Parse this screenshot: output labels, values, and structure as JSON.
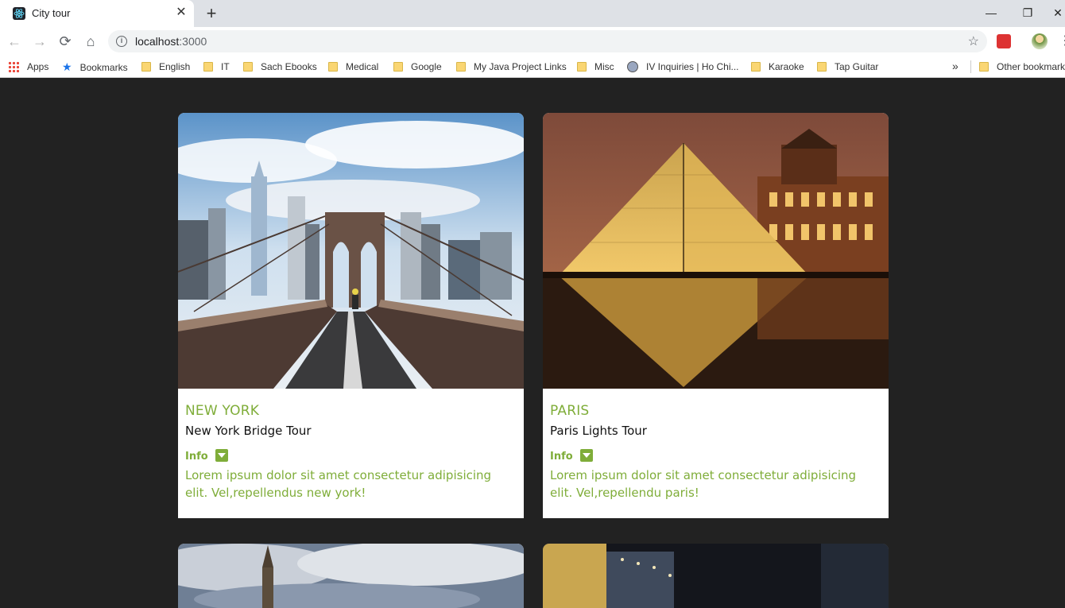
{
  "browser": {
    "tab_title": "City tour",
    "tab_close": "✕",
    "new_tab": "+",
    "window_minimize": "—",
    "window_restore": "❐",
    "window_close": "✕",
    "url_host": "localhost",
    "url_port": ":3000",
    "bookmarks": [
      {
        "label": "Apps",
        "icon": "apps-grid-icon"
      },
      {
        "label": "Bookmarks",
        "icon": "star-icon"
      },
      {
        "label": "English",
        "icon": "folder-icon"
      },
      {
        "label": "IT",
        "icon": "folder-icon"
      },
      {
        "label": "Sach Ebooks",
        "icon": "folder-icon"
      },
      {
        "label": "Medical",
        "icon": "folder-icon"
      },
      {
        "label": "Google",
        "icon": "folder-icon"
      },
      {
        "label": "My Java Project Links",
        "icon": "folder-icon"
      },
      {
        "label": "Misc",
        "icon": "folder-icon"
      },
      {
        "label": "IV Inquiries | Ho Chi...",
        "icon": "seal-icon"
      },
      {
        "label": "Karaoke",
        "icon": "folder-icon"
      },
      {
        "label": "Tap Guitar",
        "icon": "folder-icon"
      }
    ],
    "bookmarks_more": "»",
    "other_bookmarks": "Other bookmarks"
  },
  "tours": [
    {
      "city": "NEW YORK",
      "name": "New York Bridge Tour",
      "info_label": "Info",
      "description": "Lorem ipsum dolor sit amet consectetur adipisicing elit. Vel,repellendus new york!"
    },
    {
      "city": "PARIS",
      "name": "Paris Lights Tour",
      "info_label": "Info",
      "description": "Lorem ipsum dolor sit amet consectetur adipisicing elit. Vel,repellendu paris!"
    }
  ],
  "colors": {
    "accent": "#7fad39",
    "page_background": "#222222"
  }
}
